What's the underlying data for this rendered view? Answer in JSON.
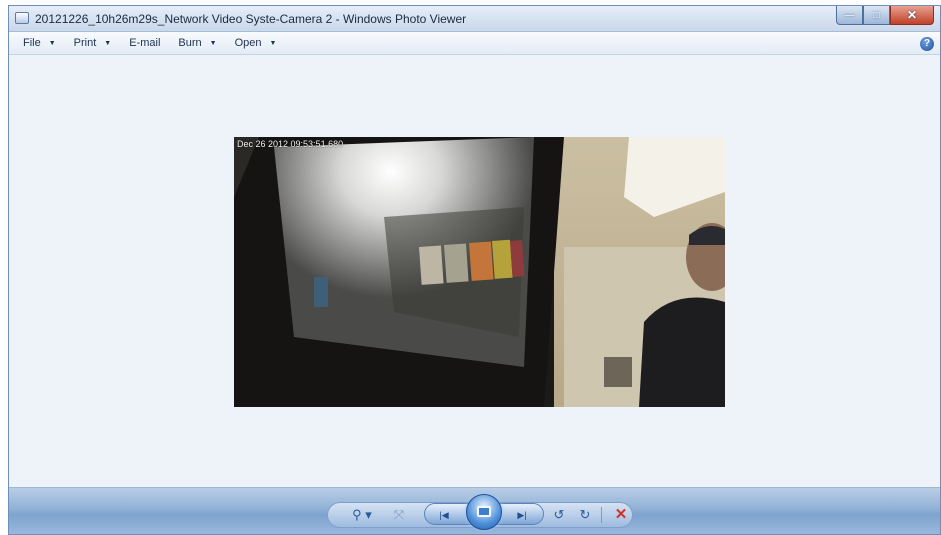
{
  "window": {
    "title": "20121226_10h26m29s_Network Video Syste-Camera 2 - Windows Photo Viewer",
    "controls": {
      "minimize": "—",
      "maximize": "□",
      "close": "✕"
    }
  },
  "menu": [
    {
      "label": "File",
      "has_dropdown": true
    },
    {
      "label": "Print",
      "has_dropdown": true
    },
    {
      "label": "E-mail",
      "has_dropdown": false
    },
    {
      "label": "Burn",
      "has_dropdown": true
    },
    {
      "label": "Open",
      "has_dropdown": true
    }
  ],
  "menu_labels": {
    "file": "File",
    "print": "Print",
    "email": "E-mail",
    "burn": "Burn",
    "open": "Open",
    "arrow": "▼"
  },
  "help": {
    "glyph": "?"
  },
  "photo": {
    "timestamp": "Dec 26 2012 09:53:51.680",
    "description_icon": "camera-frame"
  },
  "toolbar": {
    "zoom": "⚲ ▾",
    "actual_size": "⤧",
    "previous": "|◀",
    "next": "▶|",
    "rotate_ccw": "↺",
    "rotate_cw": "↻",
    "delete": "✕"
  },
  "colors": {
    "accent": "#2c5a9a",
    "delete": "#d0322a",
    "titlebar": "#c9d8eb",
    "bottombar": "#8fb0d6"
  }
}
